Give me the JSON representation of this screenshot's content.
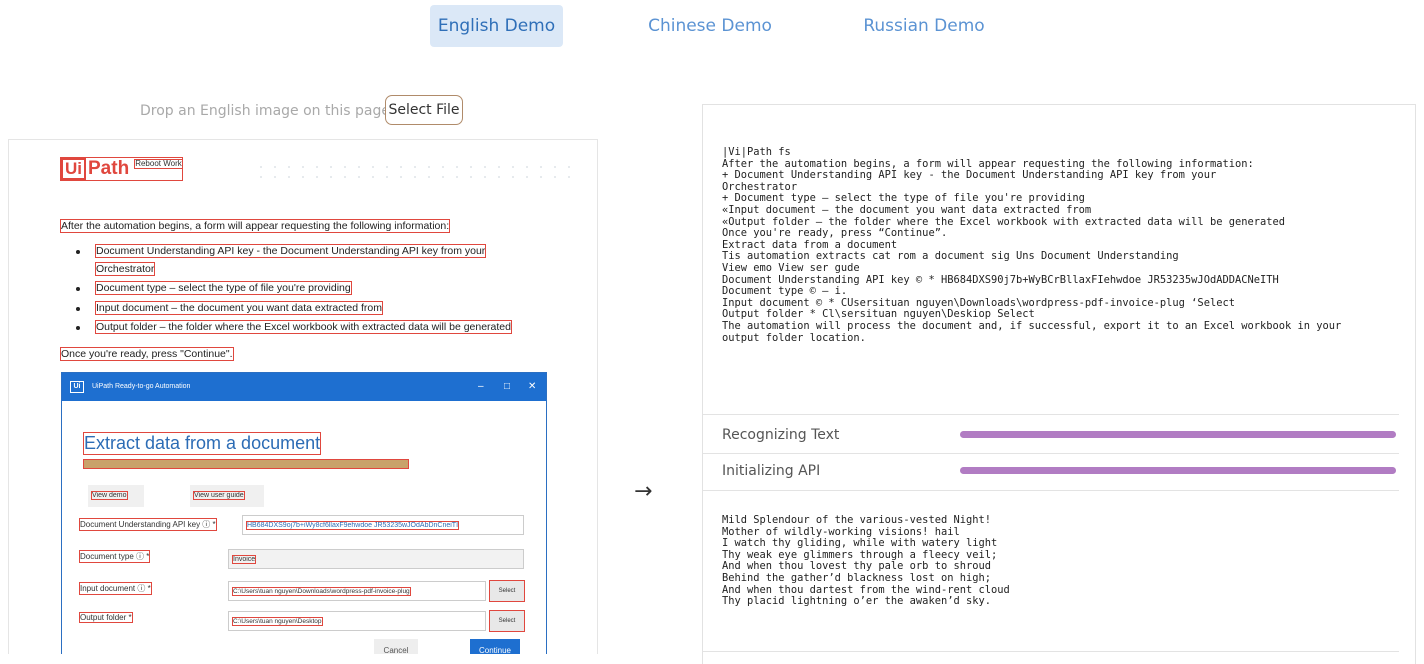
{
  "tabs": [
    {
      "label": "English Demo",
      "active": true
    },
    {
      "label": "Chinese Demo",
      "active": false
    },
    {
      "label": "Russian Demo",
      "active": false
    }
  ],
  "drop": {
    "text": "Drop an English image on this page or",
    "button": "Select File"
  },
  "doc_image": {
    "logo_ui": "Ui",
    "logo_path": "Path",
    "logo_tag": "Reboot Work",
    "intro": "After the automation begins, a form will appear requesting the following information:",
    "bullets": [
      "Document Understanding API key - the Document Understanding API key from your",
      "Orchestrator",
      "Document type – select the type of file you're providing",
      "Input document – the document you want data extracted from",
      "Output folder – the folder where the Excel workbook with extracted data will be generated"
    ],
    "closing": "Once you're ready, press \"Continue\".",
    "window": {
      "logo": "Ui",
      "title": "UiPath Ready-to-go Automation",
      "heading": "Extract data from a document",
      "btn_demo": "View demo",
      "btn_guide": "View user guide",
      "label_key": "Document Understanding API key ⓘ *",
      "value_key": "HB684DXS9oj7b+iWy8cf6llaxF9ehwdoe JR53235wJOdAbDnCneiTI",
      "label_type": "Document type ⓘ *",
      "value_type": "Invoice",
      "label_input": "Input document ⓘ *",
      "value_input": "C:\\Users\\tuan nguyen\\Downloads\\wordpress-pdf-invoice-plug",
      "label_output": "Output folder *",
      "value_output": "C:\\Users\\tuan nguyen\\Desktop",
      "select": "Select",
      "cancel": "Cancel",
      "continue": "Continue"
    }
  },
  "arrow": "→",
  "result": {
    "ocr_text": "|Vi|Path fs\nAfter the automation begins, a form will appear requesting the following information:\n+ Document Understanding API key - the Document Understanding API key from your\nOrchestrator\n+ Document type — select the type of file you're providing\n«Input document — the document you want data extracted from\n«Output folder — the folder where the Excel workbook with extracted data will be generated\nOnce you're ready, press “Continue”.\nExtract data from a document\nTis automation extracts cat rom a document sig Uns Document Understanding\nView emo View ser gude\nDocument Understanding API key © * HB684DXS90j7b+WyBCrBllaxFIehwdoe JR53235wJOdADDACNeITH\nDocument type © — i.\nInput document © * CUsersituan nguyen\\Downloads\\wordpress-pdf-invoice-plug ‘Select\nOutput folder * Cl\\sersituan nguyen\\Deskiop Select\nThe automation will process the document and, if successful, export it to an Excel workbook in your\noutput folder location.",
    "progress": [
      {
        "label": "Recognizing Text",
        "percent": 100
      },
      {
        "label": "Initializing API",
        "percent": 100
      }
    ],
    "poem": "Mild Splendour of the various-vested Night!\nMother of wildly-working visions! hail\nI watch thy gliding, while with watery light\nThy weak eye glimmers through a fleecy veil;\nAnd when thou lovest thy pale orb to shroud\nBehind the gather’d blackness lost on high;\nAnd when thou dartest from the wind-rent cloud\nThy placid lightning o’er the awaken’d sky."
  },
  "colors": {
    "accent": "#5b93d3",
    "active_tab_bg": "#dbe8f7",
    "progress": "#b17cc3",
    "annotation_box": "#e0473e"
  }
}
